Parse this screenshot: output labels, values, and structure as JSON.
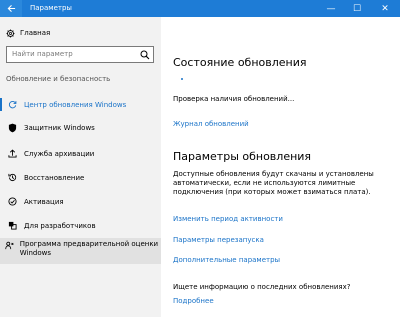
{
  "window": {
    "title": "Параметры",
    "back_icon": "back-arrow-icon",
    "minimize_glyph": "—",
    "maximize_glyph": "☐",
    "close_glyph": "✕"
  },
  "sidebar": {
    "home": {
      "label": "Главная",
      "icon": "gear-icon"
    },
    "search": {
      "placeholder": "Найти параметр",
      "icon": "search-icon"
    },
    "group_heading": "Обновление и безопасность",
    "items": [
      {
        "label": "Центр обновления Windows",
        "icon": "refresh-icon",
        "active": true
      },
      {
        "label": "Защитник Windows",
        "icon": "shield-icon",
        "active": false
      },
      {
        "label": "Служба архивации",
        "icon": "upload-icon",
        "active": false
      },
      {
        "label": "Восстановление",
        "icon": "history-icon",
        "active": false
      },
      {
        "label": "Активация",
        "icon": "check-circle-icon",
        "active": false
      },
      {
        "label": "Для разработчиков",
        "icon": "developer-icon",
        "active": false
      },
      {
        "label": "Программа предварительной оценки Windows",
        "icon": "insider-icon",
        "active": false
      }
    ]
  },
  "main": {
    "status_heading": "Состояние обновления",
    "status_text": "Проверка наличия обновлений...",
    "history_link": "Журнал обновлений",
    "settings_heading": "Параметры обновления",
    "settings_desc": "Доступные обновления будут скачаны и установлены автоматически, если не используются лимитные подключения (при которых может взиматься плата).",
    "active_hours_link": "Изменить период активности",
    "restart_link": "Параметры перезапуска",
    "advanced_link": "Дополнительные параметры",
    "info_question": "Ищете информацию о последних обновлениях?",
    "more_link": "Подробнее"
  },
  "colors": {
    "titlebar": "#1e7cd6",
    "accent": "#1a73c8",
    "sidebar_bg": "#f2f2f2",
    "hover_bg": "#e1e1e1"
  }
}
